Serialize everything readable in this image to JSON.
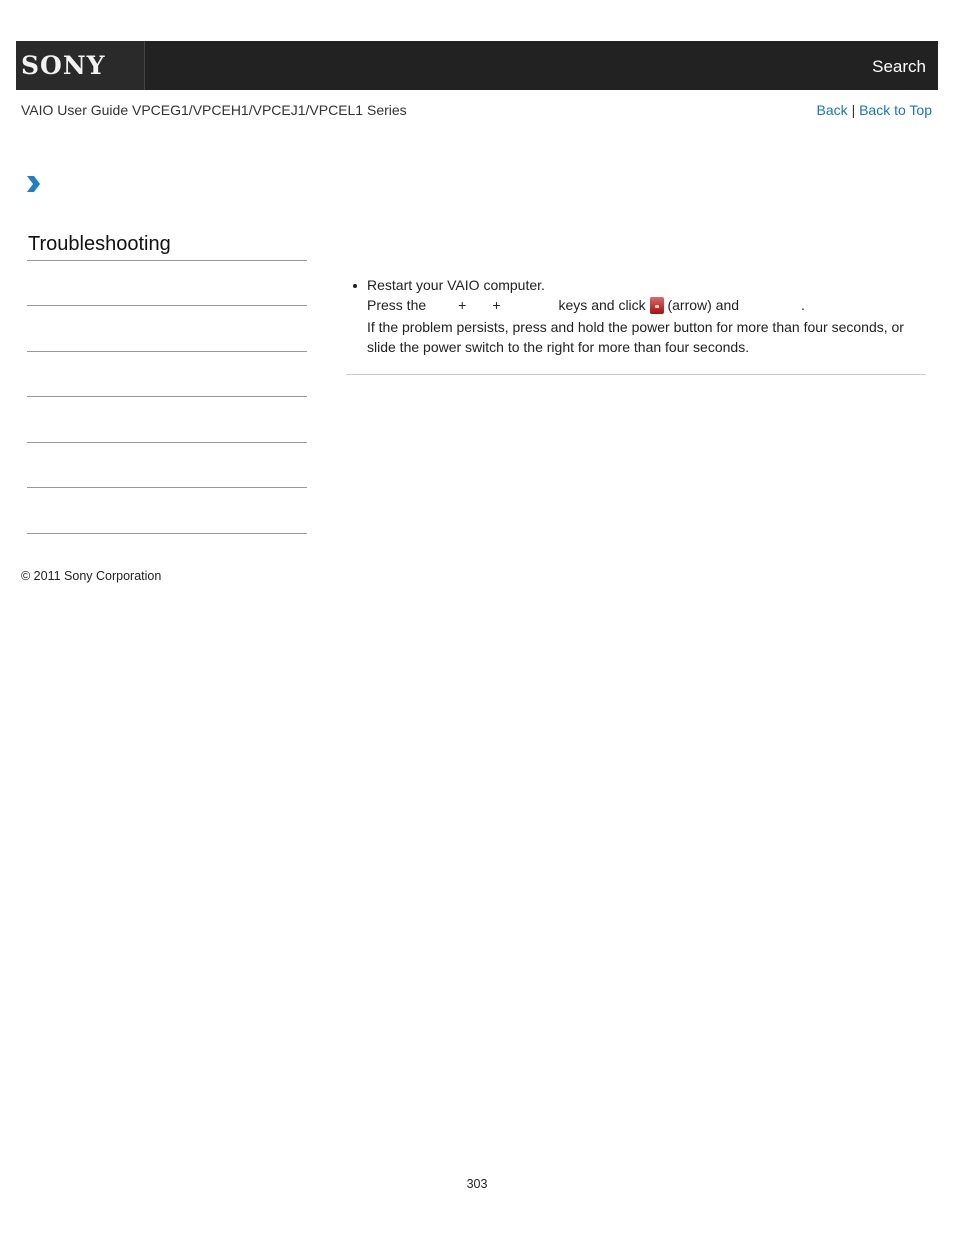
{
  "header": {
    "logo": "SONY",
    "search_label": "Search"
  },
  "subheader": {
    "guide_title": "VAIO User Guide VPCEG1/VPCEH1/VPCEJ1/VPCEL1 Series",
    "back_label": "Back",
    "separator": "|",
    "back_to_top_label": "Back to Top"
  },
  "breadcrumb": {
    "icon": "chevron-right-icon"
  },
  "sidebar": {
    "title": "Troubleshooting",
    "items": [
      "",
      "",
      "",
      "",
      "",
      ""
    ]
  },
  "content": {
    "bullet": "Restart your VAIO computer.",
    "press_the": "Press the",
    "plus1": "+",
    "plus2": "+",
    "keys_and_click": "keys and click",
    "arrow_icon": "red-arrow-button-icon",
    "arrow_and": "(arrow) and",
    "period": ".",
    "persist_text": "If the problem persists, press and hold the power button for more than four seconds, or slide the power switch to the right for more than four seconds."
  },
  "footer": {
    "copyright": "© 2011 Sony Corporation",
    "page_number": "303"
  },
  "colors": {
    "header_bg": "#222222",
    "link": "#1a73c8",
    "chevron": "#1f7fc4"
  }
}
